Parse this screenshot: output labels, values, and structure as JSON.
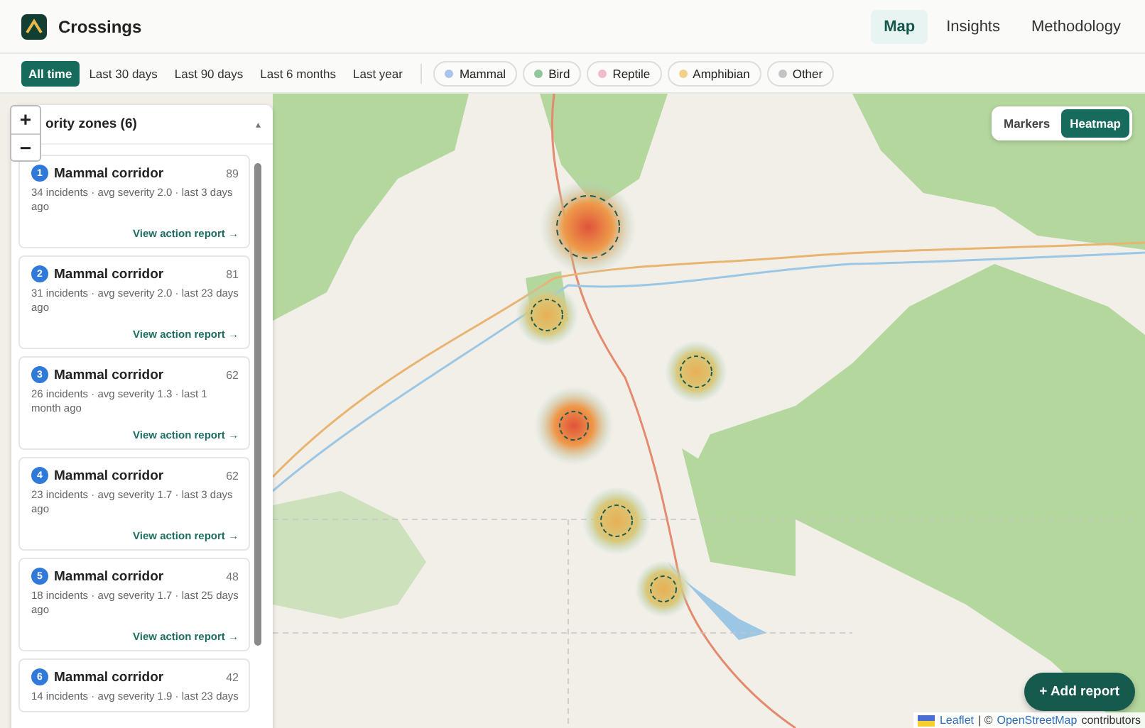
{
  "app": {
    "title": "Crossings"
  },
  "nav": [
    {
      "label": "Map",
      "selected": true
    },
    {
      "label": "Insights",
      "selected": false
    },
    {
      "label": "Methodology",
      "selected": false
    }
  ],
  "time_filters": [
    {
      "label": "All time",
      "selected": true
    },
    {
      "label": "Last 30 days",
      "selected": false
    },
    {
      "label": "Last 90 days",
      "selected": false
    },
    {
      "label": "Last 6 months",
      "selected": false
    },
    {
      "label": "Last year",
      "selected": false
    }
  ],
  "legend": [
    {
      "label": "Mammal",
      "color": "#a9c4ea"
    },
    {
      "label": "Bird",
      "color": "#8fc79a"
    },
    {
      "label": "Reptile",
      "color": "#f0bccb"
    },
    {
      "label": "Amphibian",
      "color": "#f2d08c"
    },
    {
      "label": "Other",
      "color": "#c4c4c4"
    }
  ],
  "zoom_controls": [
    "+",
    "−"
  ],
  "panel": {
    "title": "ority zones (6)",
    "collapse": "▴",
    "zones": [
      {
        "rank": "1",
        "name": "Mammal corridor",
        "score": "89",
        "detail": "34 incidents · avg severity 2.0 · last 3 days ago",
        "link": "View action report →"
      },
      {
        "rank": "2",
        "name": "Mammal corridor",
        "score": "81",
        "detail": "31 incidents · avg severity 2.0 · last 23 days ago",
        "link": "View action report →"
      },
      {
        "rank": "3",
        "name": "Mammal corridor",
        "score": "62",
        "detail": "26 incidents · avg severity 1.3 · last 1 month ago",
        "link": "View action report →"
      },
      {
        "rank": "4",
        "name": "Mammal corridor",
        "score": "62",
        "detail": "23 incidents · avg severity 1.7 · last 3 days ago",
        "link": "View action report →"
      },
      {
        "rank": "5",
        "name": "Mammal corridor",
        "score": "48",
        "detail": "18 incidents · avg severity 1.7 · last 25 days ago",
        "link": "View action report →"
      },
      {
        "rank": "6",
        "name": "Mammal corridor",
        "score": "42",
        "detail": "14 incidents · avg severity 1.9 · last 23 days"
      }
    ]
  },
  "view_toggle": [
    {
      "label": "Markers",
      "selected": false
    },
    {
      "label": "Heatmap",
      "selected": true
    }
  ],
  "add_button": "+ Add report",
  "attribution": {
    "link_1": "Leaflet",
    "separator": "| ©",
    "link_2": "OpenStreetMap",
    "suffix": "contributors"
  }
}
